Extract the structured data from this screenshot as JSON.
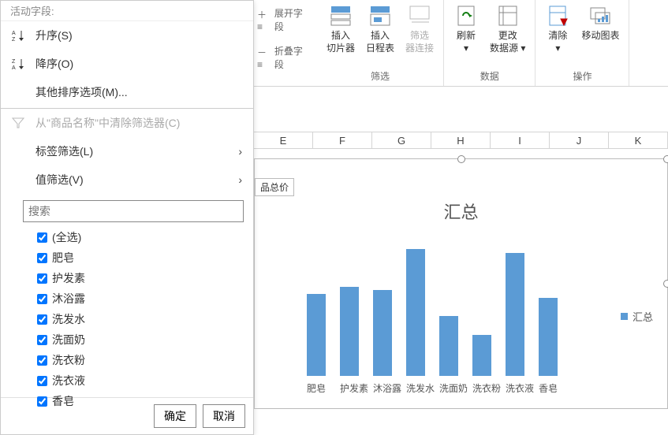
{
  "ribbon": {
    "group_small": {
      "item1": "展开字段",
      "item2": "折叠字段"
    },
    "filter_group": {
      "title": "筛选",
      "slicer": "插入\n切片器",
      "timeline": "插入\n日程表",
      "conn": "筛选\n器连接"
    },
    "data_group": {
      "title": "数据",
      "refresh": "刷新",
      "changesrc": "更改\n数据源"
    },
    "op_group": {
      "title": "操作",
      "clear": "清除",
      "move": "移动图表"
    }
  },
  "active_field_label": "活动字段:",
  "columns": [
    "E",
    "F",
    "G",
    "H",
    "I",
    "J",
    "K"
  ],
  "menu": {
    "sort_asc": "升序(S)",
    "sort_desc": "降序(O)",
    "more_sort": "其他排序选项(M)...",
    "clear_filter": "从\"商品名称\"中清除筛选器(C)",
    "label_filter": "标签筛选(L)",
    "value_filter": "值筛选(V)",
    "search_placeholder": "搜索",
    "items": [
      {
        "label": "(全选)",
        "checked": true
      },
      {
        "label": "肥皂",
        "checked": true
      },
      {
        "label": "护发素",
        "checked": true
      },
      {
        "label": "沐浴露",
        "checked": true
      },
      {
        "label": "洗发水",
        "checked": true
      },
      {
        "label": "洗面奶",
        "checked": true
      },
      {
        "label": "洗衣粉",
        "checked": true
      },
      {
        "label": "洗衣液",
        "checked": true
      },
      {
        "label": "香皂",
        "checked": true
      }
    ],
    "ok": "确定",
    "cancel": "取消"
  },
  "chart_tag": "品总价",
  "chart_data": {
    "type": "bar",
    "title": "汇总",
    "legend": "汇总",
    "categories": [
      "肥皂",
      "护发素",
      "沐浴露",
      "洗发水",
      "洗面奶",
      "洗衣粉",
      "洗衣液",
      "香皂"
    ],
    "values": [
      110,
      120,
      115,
      170,
      80,
      55,
      165,
      105
    ],
    "ylim": [
      0,
      180
    ]
  },
  "colors": {
    "bar": "#5b9bd5"
  }
}
